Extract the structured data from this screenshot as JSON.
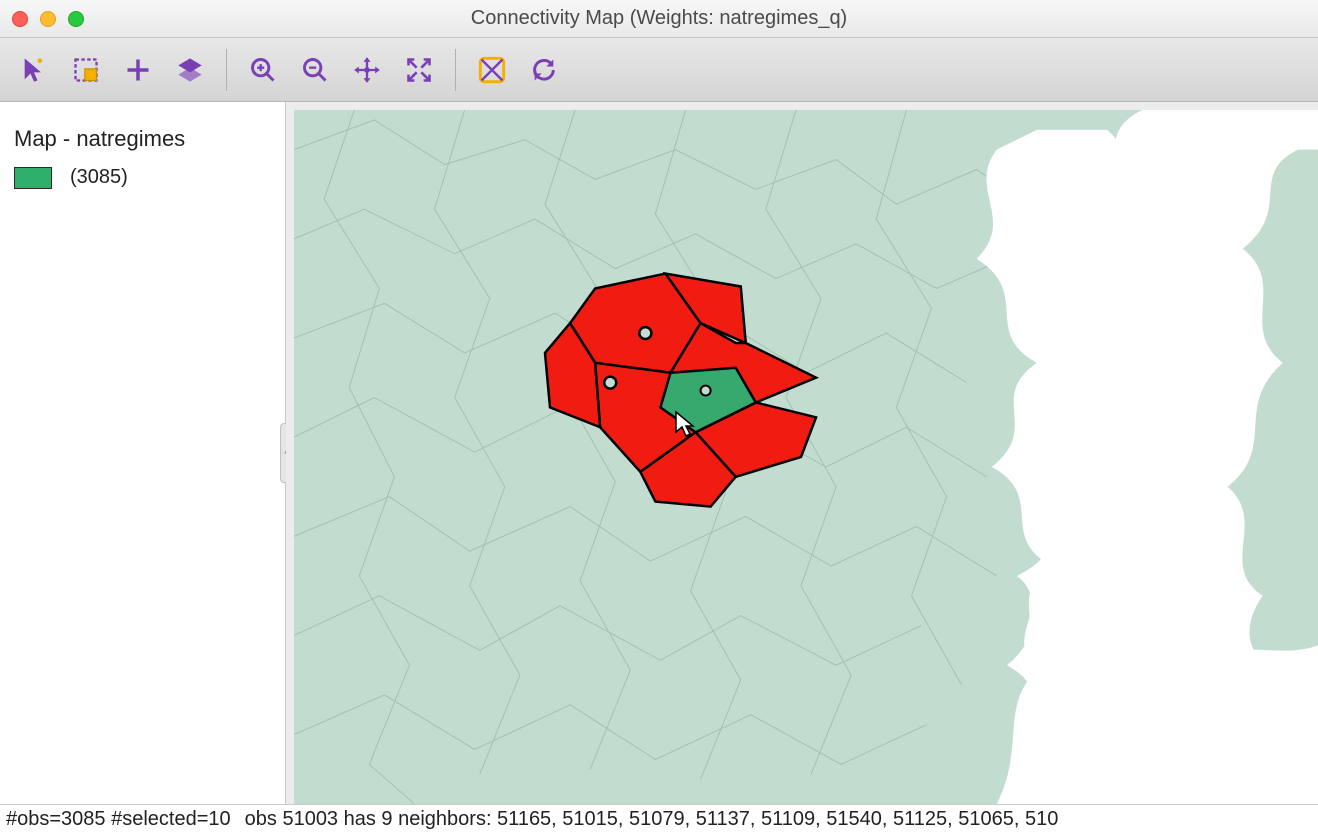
{
  "window": {
    "title": "Connectivity Map (Weights: natregimes_q)"
  },
  "toolbar": {
    "pointer": "pointer-icon",
    "rectangle_select": "select-rect-icon",
    "add": "plus-icon",
    "layers": "layers-icon",
    "zoom_in": "zoom-in-icon",
    "zoom_out": "zoom-out-icon",
    "pan": "pan-icon",
    "fit": "fit-extent-icon",
    "basemap": "basemap-icon",
    "refresh": "refresh-icon"
  },
  "legend": {
    "title": "Map - natregimes",
    "items": [
      {
        "color": "#2eb06a",
        "label": "(3085)"
      }
    ]
  },
  "status": {
    "left": "#obs=3085 #selected=10",
    "right": "obs 51003 has 9 neighbors: 51165, 51015, 51079, 51137, 51109, 51540, 51125, 51065, 510"
  },
  "map": {
    "selected_fill": "#37a96f",
    "neighbor_fill": "#f01c12",
    "base_fill": "#c2ddcf",
    "base_stroke": "#9bc0ae",
    "water": "#ffffff"
  }
}
